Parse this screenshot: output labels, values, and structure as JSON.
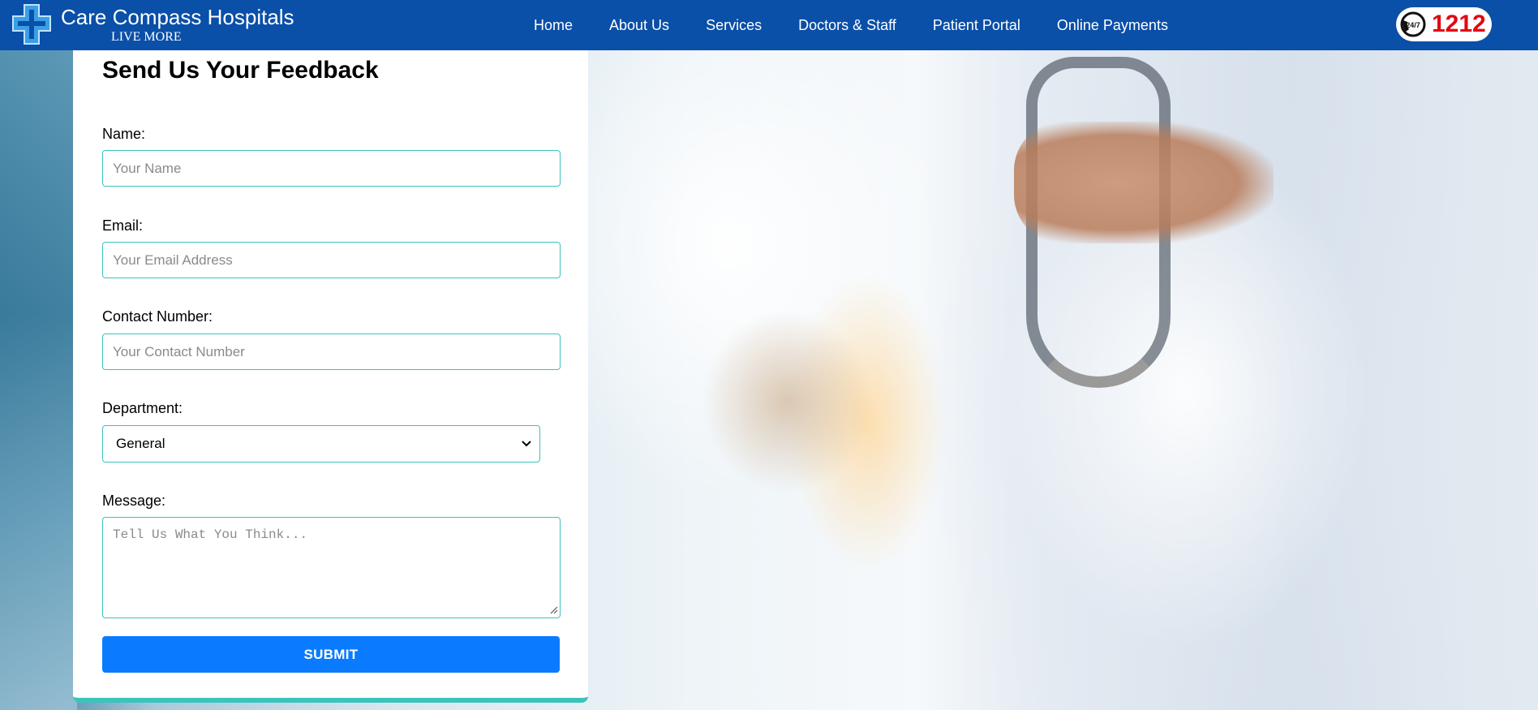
{
  "header": {
    "brand_name": "Care Compass Hospitals",
    "tagline": "LIVE MORE",
    "logo_icon": "medical-cross-icon",
    "nav": [
      {
        "label": "Home"
      },
      {
        "label": "About Us"
      },
      {
        "label": "Services"
      },
      {
        "label": "Doctors & Staff"
      },
      {
        "label": "Patient Portal"
      },
      {
        "label": "Online Payments"
      }
    ],
    "hotline": {
      "icon": "24-7-phone-icon",
      "icon_text": "24/7",
      "number": "1212"
    }
  },
  "form": {
    "title": "Send Us Your Feedback",
    "name_label": "Name:",
    "name_placeholder": "Your Name",
    "email_label": "Email:",
    "email_placeholder": "Your Email Address",
    "contact_label": "Contact Number:",
    "contact_placeholder": "Your Contact Number",
    "department_label": "Department:",
    "department_value": "General",
    "message_label": "Message:",
    "message_placeholder": "Tell Us What You Think...",
    "submit_label": "SUBMIT"
  },
  "colors": {
    "header_bg": "#0a4fa8",
    "accent_teal": "#3cc3bb",
    "submit_bg": "#0a7bff",
    "hotline_red": "#e30613"
  }
}
